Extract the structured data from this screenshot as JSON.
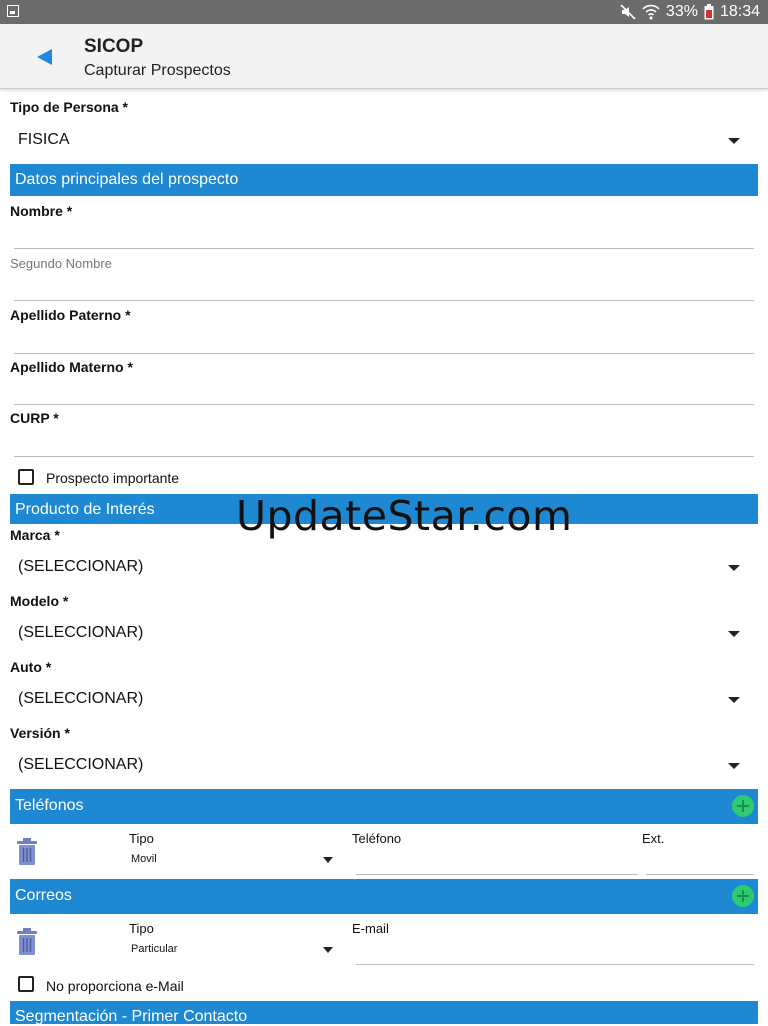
{
  "status_bar": {
    "battery": "33%",
    "time": "18:34"
  },
  "app_bar": {
    "title": "SICOP",
    "subtitle": "Capturar Prospectos"
  },
  "tipo_persona": {
    "label": "Tipo de Persona *",
    "value": "FISICA"
  },
  "sections": {
    "datos": "Datos principales del prospecto",
    "producto": "Producto de Interés",
    "telefonos": "Teléfonos",
    "correos": "Correos",
    "segmentacion": "Segmentación - Primer Contacto"
  },
  "fields": {
    "nombre": {
      "label": "Nombre *",
      "value": ""
    },
    "segundo_nombre": {
      "label": "Segundo Nombre",
      "value": ""
    },
    "apellido_paterno": {
      "label": "Apellido Paterno *",
      "value": ""
    },
    "apellido_materno": {
      "label": "Apellido Materno *",
      "value": ""
    },
    "curp": {
      "label": "CURP *",
      "value": ""
    }
  },
  "prospecto_importante": {
    "label": "Prospecto importante",
    "checked": false
  },
  "producto": {
    "marca": {
      "label": "Marca *",
      "value": "(SELECCIONAR)"
    },
    "modelo": {
      "label": "Modelo *",
      "value": "(SELECCIONAR)"
    },
    "auto": {
      "label": "Auto *",
      "value": "(SELECCIONAR)"
    },
    "version": {
      "label": "Versión *",
      "value": "(SELECCIONAR)"
    }
  },
  "telefono_row": {
    "tipo_label": "Tipo",
    "tipo_value": "Movil",
    "telefono_label": "Teléfono",
    "ext_label": "Ext."
  },
  "correo_row": {
    "tipo_label": "Tipo",
    "tipo_value": "Particular",
    "email_label": "E-mail"
  },
  "no_email": {
    "label": "No proporciona e-Mail",
    "checked": false
  },
  "watermark": "UpdateStar.com",
  "colors": {
    "section_header": "#1e88d2",
    "add_button": "#2ecc71",
    "back_arrow": "#1e88e5",
    "trash": "#6f7fbf"
  }
}
